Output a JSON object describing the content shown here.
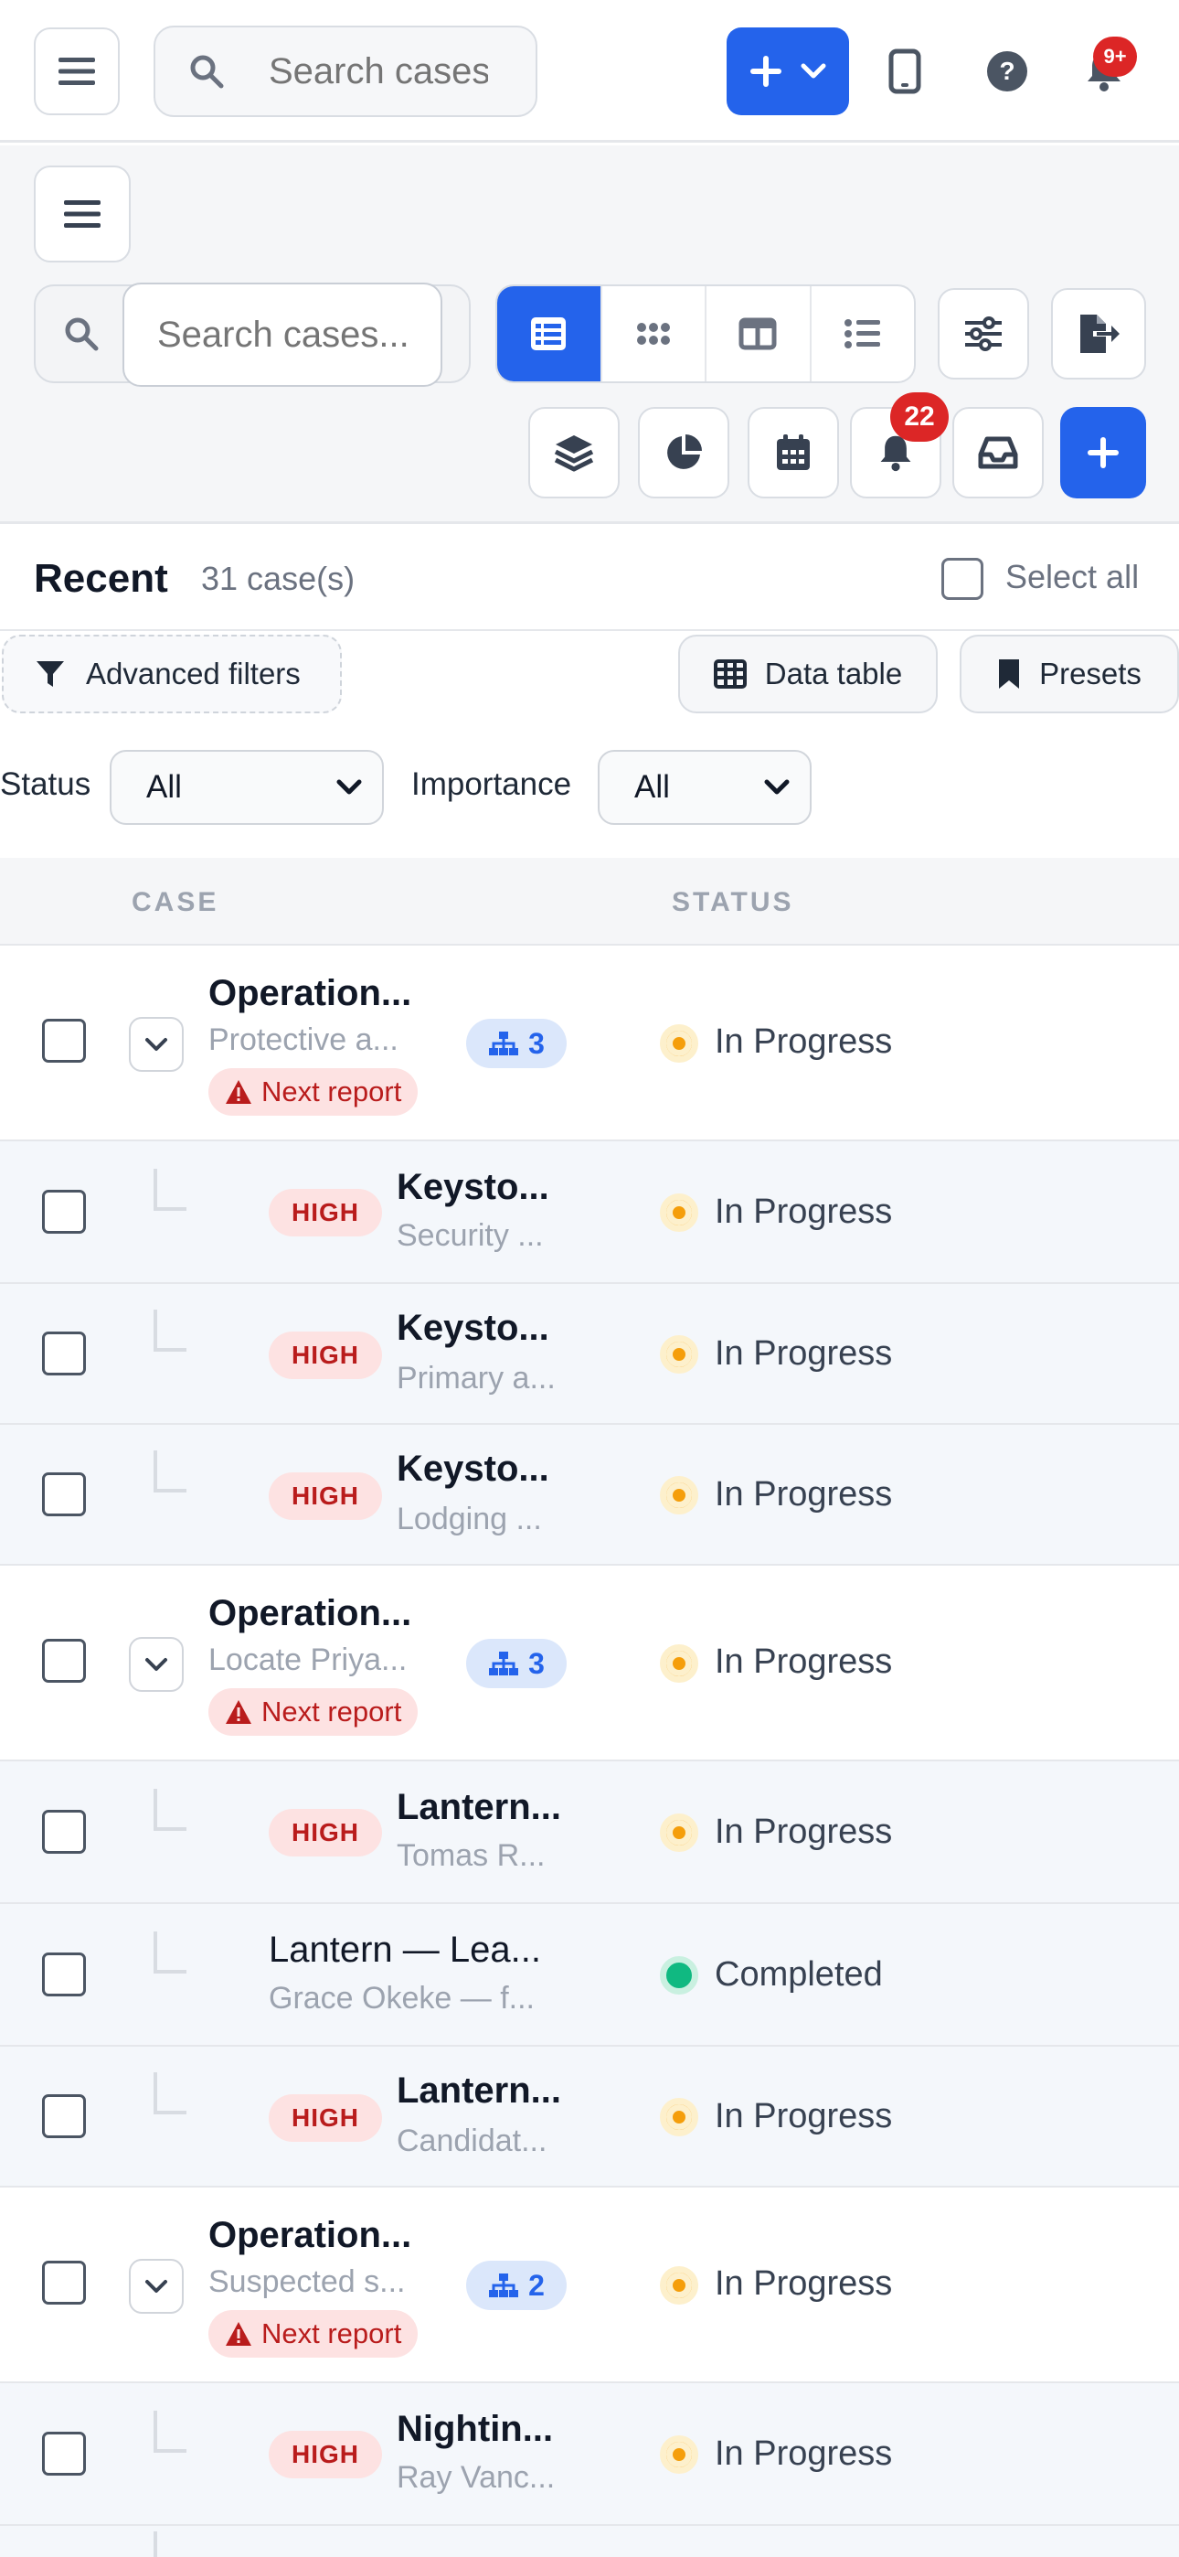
{
  "topbar": {
    "search_placeholder": "Search cases...",
    "notification_badge": "9+"
  },
  "toolbar": {
    "search_placeholder": "Search cases...",
    "notification_count": "22"
  },
  "section": {
    "title": "Recent",
    "count": "31 case(s)",
    "select_all": "Select all"
  },
  "filters": {
    "advanced": "Advanced filters",
    "data_table": "Data table",
    "presets": "Presets",
    "status_label": "Status",
    "status_value": "All",
    "importance_label": "Importance",
    "importance_value": "All"
  },
  "table": {
    "col_case": "CASE",
    "col_status": "STATUS",
    "rows": [
      {
        "type": "parent",
        "title": "Operation...",
        "subtitle": "Protective a...",
        "tag": "Next report",
        "subcount": "3",
        "status": "In Progress"
      },
      {
        "type": "child",
        "priority": "HIGH",
        "title": "Keysto...",
        "subtitle": "Security ...",
        "status": "In Progress"
      },
      {
        "type": "child",
        "priority": "HIGH",
        "title": "Keysto...",
        "subtitle": "Primary a...",
        "status": "In Progress"
      },
      {
        "type": "child",
        "priority": "HIGH",
        "title": "Keysto...",
        "subtitle": "Lodging ...",
        "status": "In Progress"
      },
      {
        "type": "parent",
        "title": "Operation...",
        "subtitle": "Locate Priya...",
        "tag": "Next report",
        "subcount": "3",
        "status": "In Progress"
      },
      {
        "type": "child",
        "priority": "HIGH",
        "title": "Lantern...",
        "subtitle": "Tomas R...",
        "status": "In Progress"
      },
      {
        "type": "child",
        "priority": "",
        "title": "Lantern — Lea...",
        "subtitle": "Grace Okeke — f...",
        "status": "Completed"
      },
      {
        "type": "child",
        "priority": "HIGH",
        "title": "Lantern...",
        "subtitle": "Candidat...",
        "status": "In Progress"
      },
      {
        "type": "parent",
        "title": "Operation...",
        "subtitle": "Suspected s...",
        "tag": "Next report",
        "subcount": "2",
        "status": "In Progress"
      },
      {
        "type": "child",
        "priority": "HIGH",
        "title": "Nightin...",
        "subtitle": "Ray Vanc...",
        "status": "In Progress"
      }
    ]
  },
  "colors": {
    "accent": "#2463eb",
    "in_progress": "#f59e0b",
    "completed": "#10b981",
    "high_bg": "#fde2e2",
    "high_text": "#b91c1c"
  }
}
